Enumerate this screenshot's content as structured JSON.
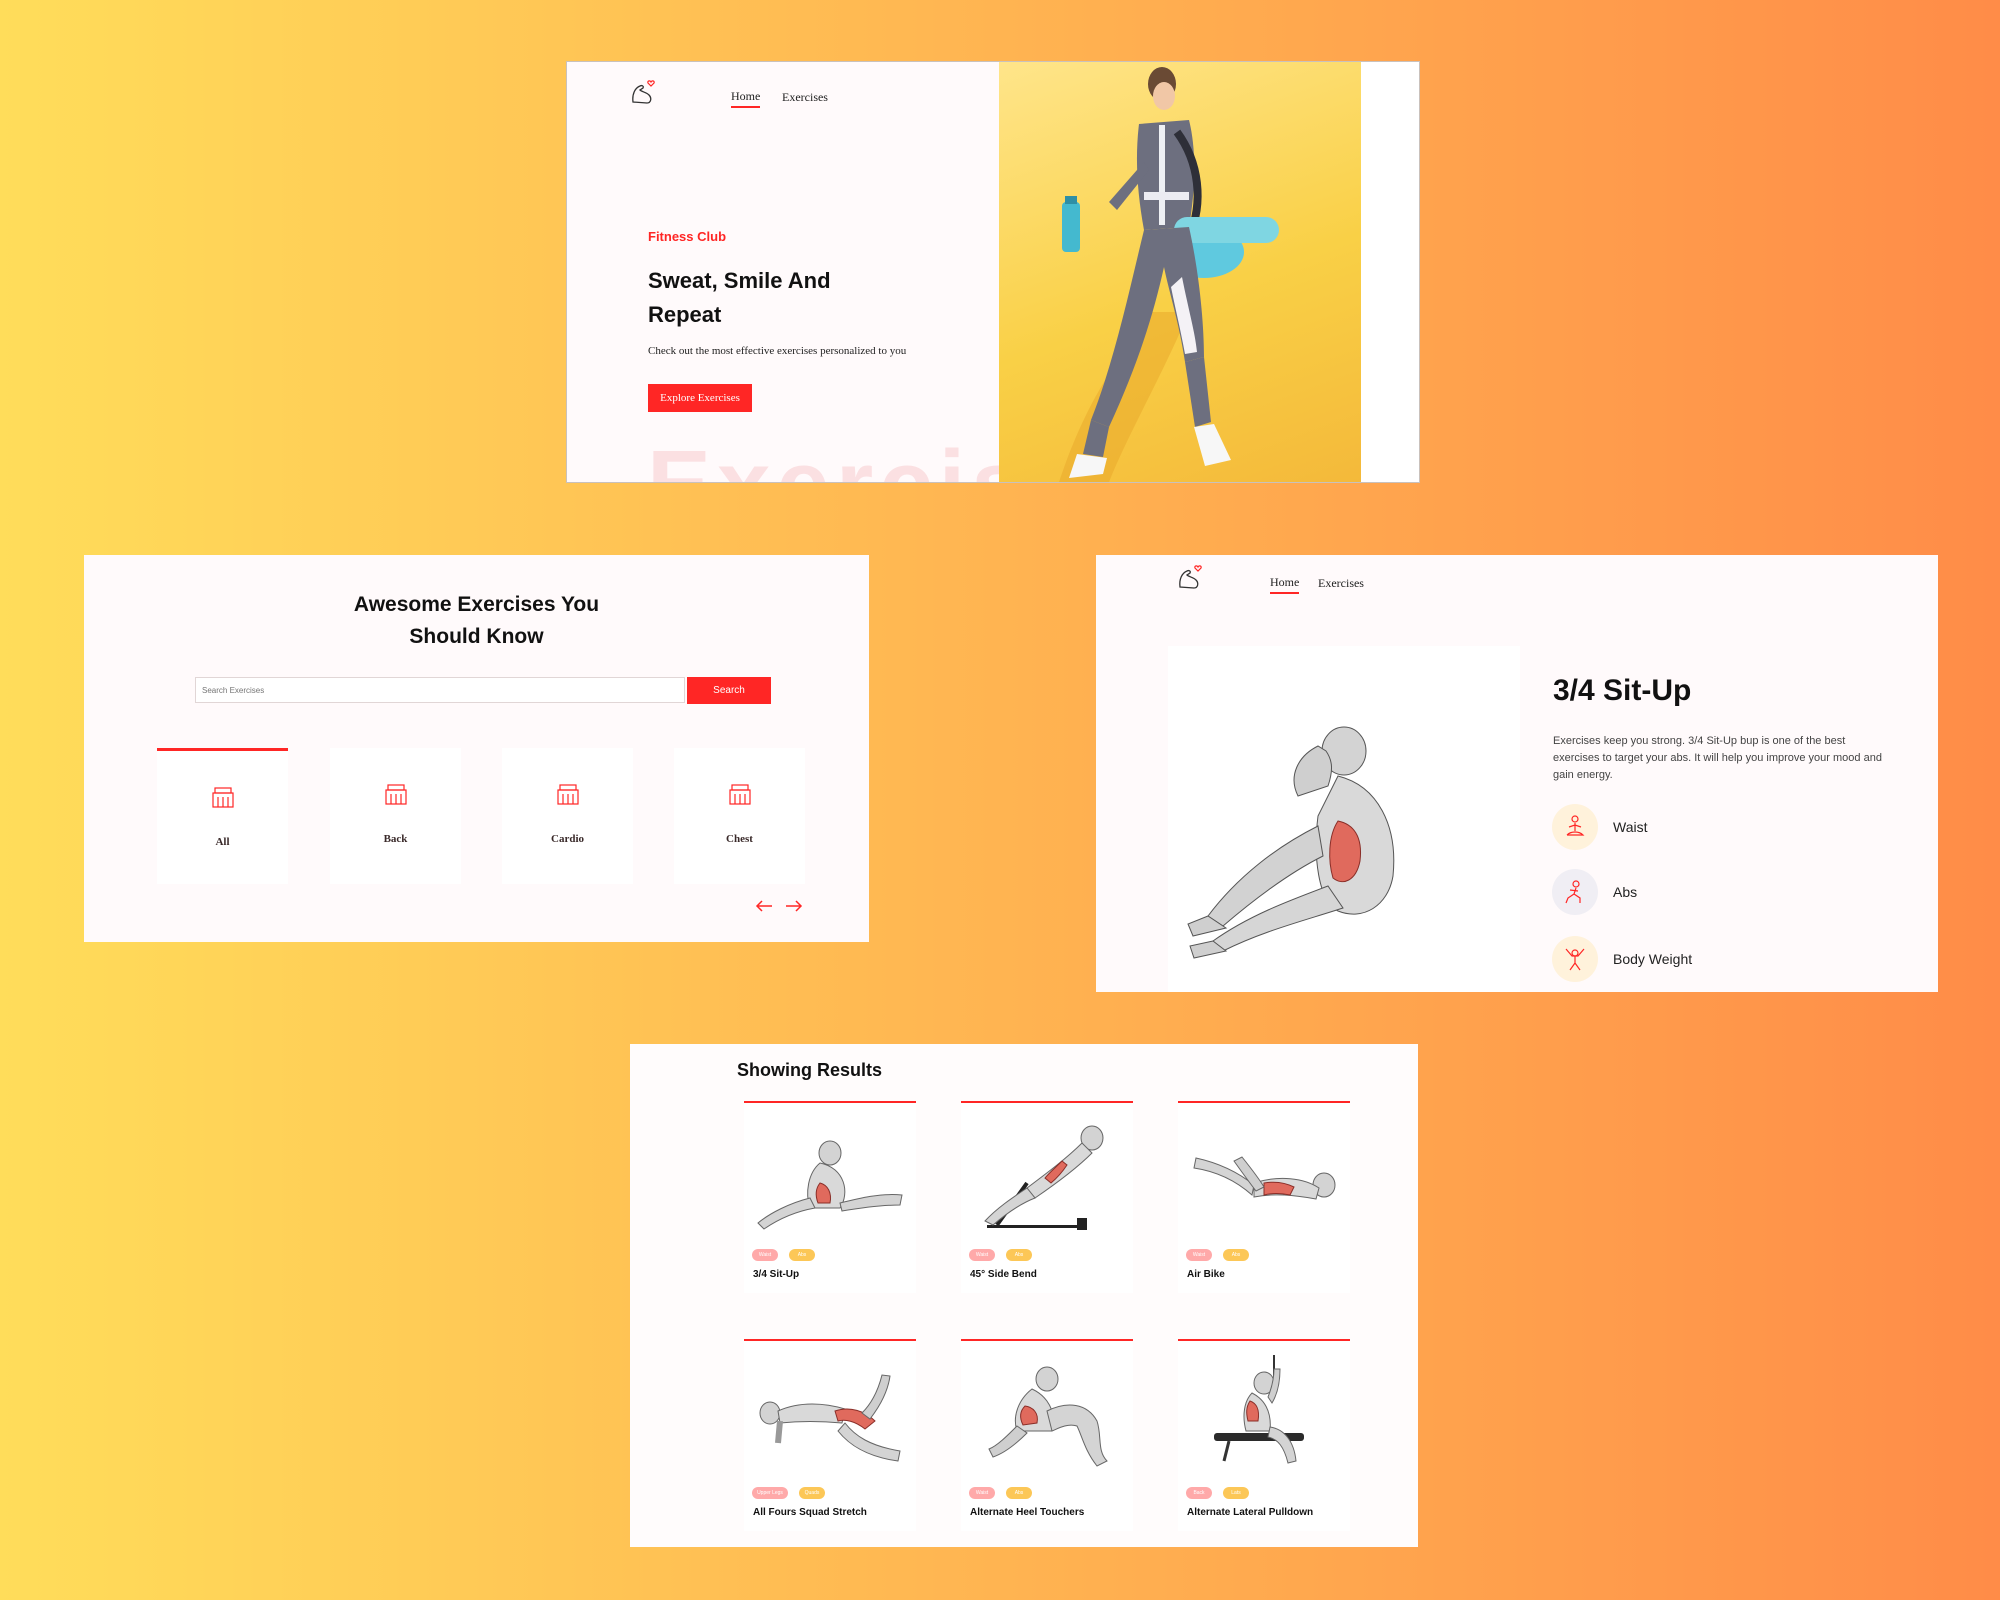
{
  "nav": {
    "home": "Home",
    "exercises": "Exercises"
  },
  "hero": {
    "eyebrow": "Fitness Club",
    "headline": "Sweat, Smile And Repeat",
    "subtitle": "Check out the most effective exercises personalized to you",
    "cta": "Explore Exercises",
    "bg_word": "Exercise"
  },
  "categories_section": {
    "title": "Awesome Exercises You Should Know",
    "search_placeholder": "Search Exercises",
    "search_button": "Search",
    "items": [
      {
        "label": "All"
      },
      {
        "label": "Back"
      },
      {
        "label": "Cardio"
      },
      {
        "label": "Chest"
      }
    ],
    "prev_arrow": "←",
    "next_arrow": "→"
  },
  "detail": {
    "title": "3/4 Sit-Up",
    "description": "Exercises keep you strong. 3/4 Sit-Up bup is one of the best exercises to target your abs. It will help you improve your mood and gain energy.",
    "attributes": [
      {
        "label": "Waist",
        "icon": "meditation-icon"
      },
      {
        "label": "Abs",
        "icon": "lunge-icon"
      },
      {
        "label": "Body Weight",
        "icon": "stretching-icon"
      }
    ]
  },
  "results": {
    "heading": "Showing Results",
    "cards": [
      {
        "name": "3/4 Sit-Up",
        "tag1": "Waist",
        "tag2": "Abs"
      },
      {
        "name": "45° Side Bend",
        "tag1": "Waist",
        "tag2": "Abs"
      },
      {
        "name": "Air Bike",
        "tag1": "Waist",
        "tag2": "Abs"
      },
      {
        "name": "All Fours Squad Stretch",
        "tag1": "Upper Legs",
        "tag2": "Quads"
      },
      {
        "name": "Alternate Heel Touchers",
        "tag1": "Waist",
        "tag2": "Abs"
      },
      {
        "name": "Alternate Lateral Pulldown",
        "tag1": "Back",
        "tag2": "Lats"
      }
    ]
  },
  "colors": {
    "accent": "#ff2625",
    "tag_pink": "#ffa9a9",
    "tag_yellow": "#fcc757"
  }
}
